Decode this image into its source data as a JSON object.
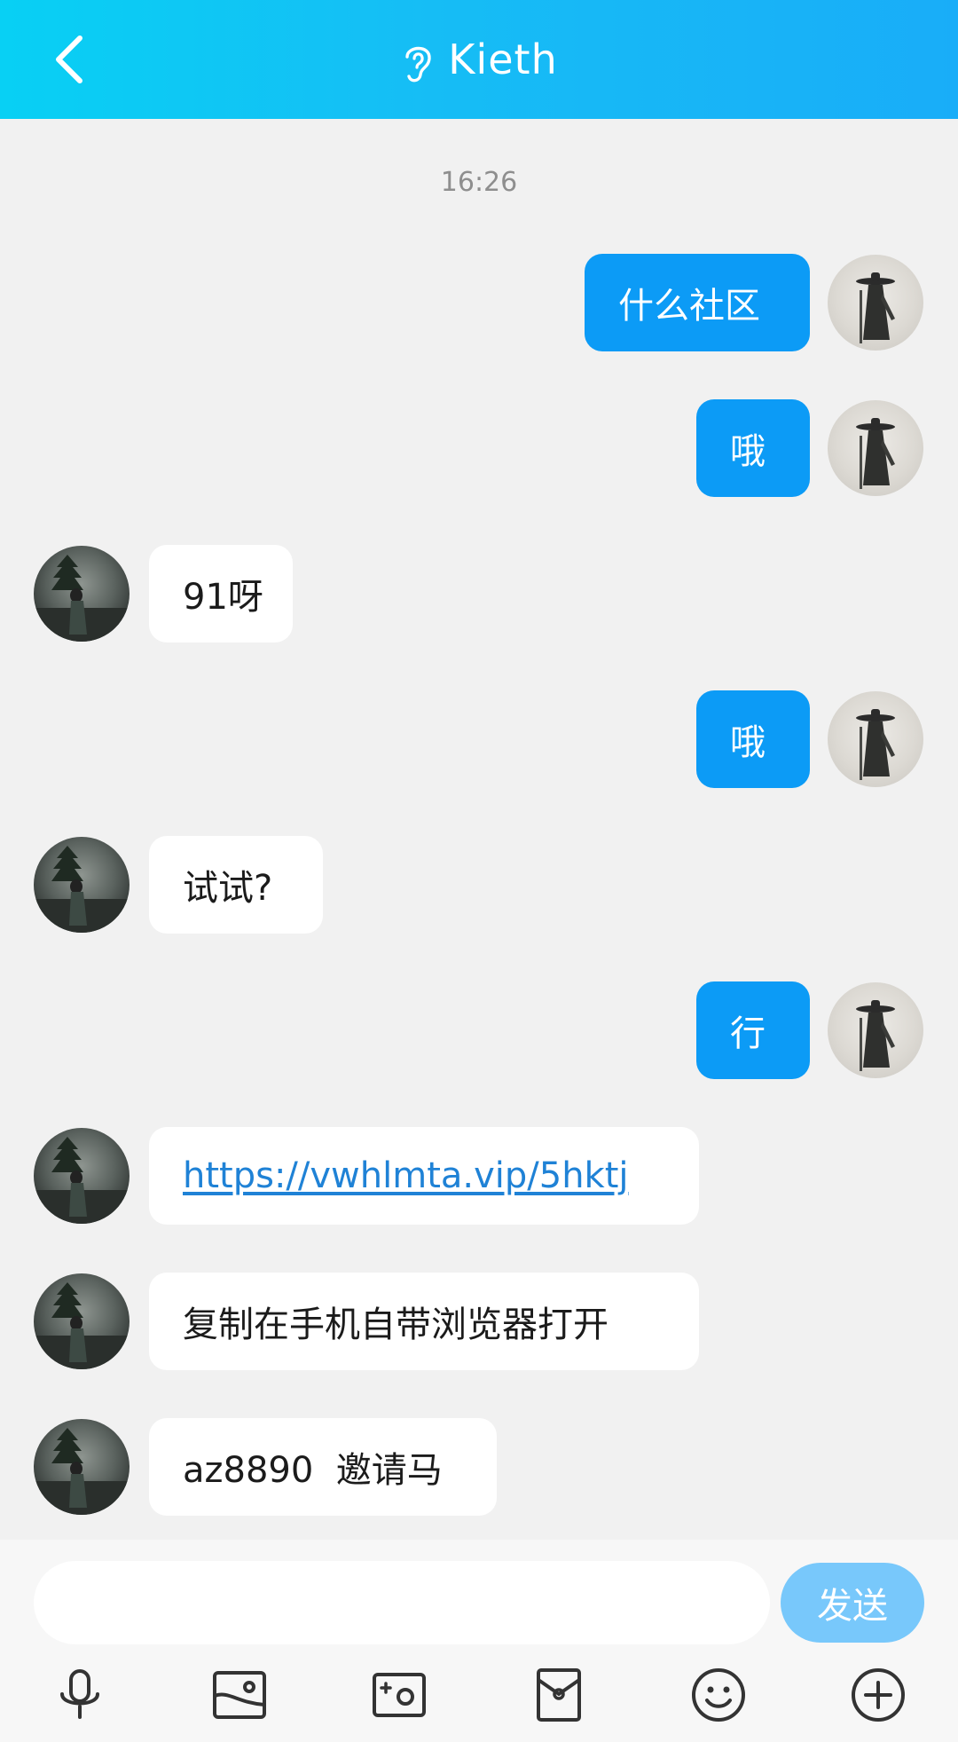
{
  "header": {
    "title": "Kieth",
    "back_icon": "chevron-left-icon",
    "status_icon": "ear-icon"
  },
  "chat": {
    "timestamp": "16:26",
    "messages": [
      {
        "from": "me",
        "text": "什么社区"
      },
      {
        "from": "me",
        "text": "哦"
      },
      {
        "from": "other",
        "text": "91呀"
      },
      {
        "from": "me",
        "text": "哦"
      },
      {
        "from": "other",
        "text": "试试?"
      },
      {
        "from": "me",
        "text": "行"
      },
      {
        "from": "other",
        "text": "https://vwhlmta.vip/5hktj",
        "is_link": true
      },
      {
        "from": "other",
        "text": "复制在手机自带浏览器打开"
      },
      {
        "from": "other",
        "text": "az8890  邀请马"
      }
    ]
  },
  "composer": {
    "input_value": "",
    "send_label": "发送",
    "tools": [
      "microphone-icon",
      "image-icon",
      "camera-icon",
      "red-packet-icon",
      "emoji-icon",
      "plus-icon"
    ]
  },
  "colors": {
    "header_start": "#08d0f4",
    "header_end": "#19adf8",
    "my_bubble": "#0c9bf6",
    "send_button": "#78c8fb",
    "link": "#1f82d6"
  }
}
